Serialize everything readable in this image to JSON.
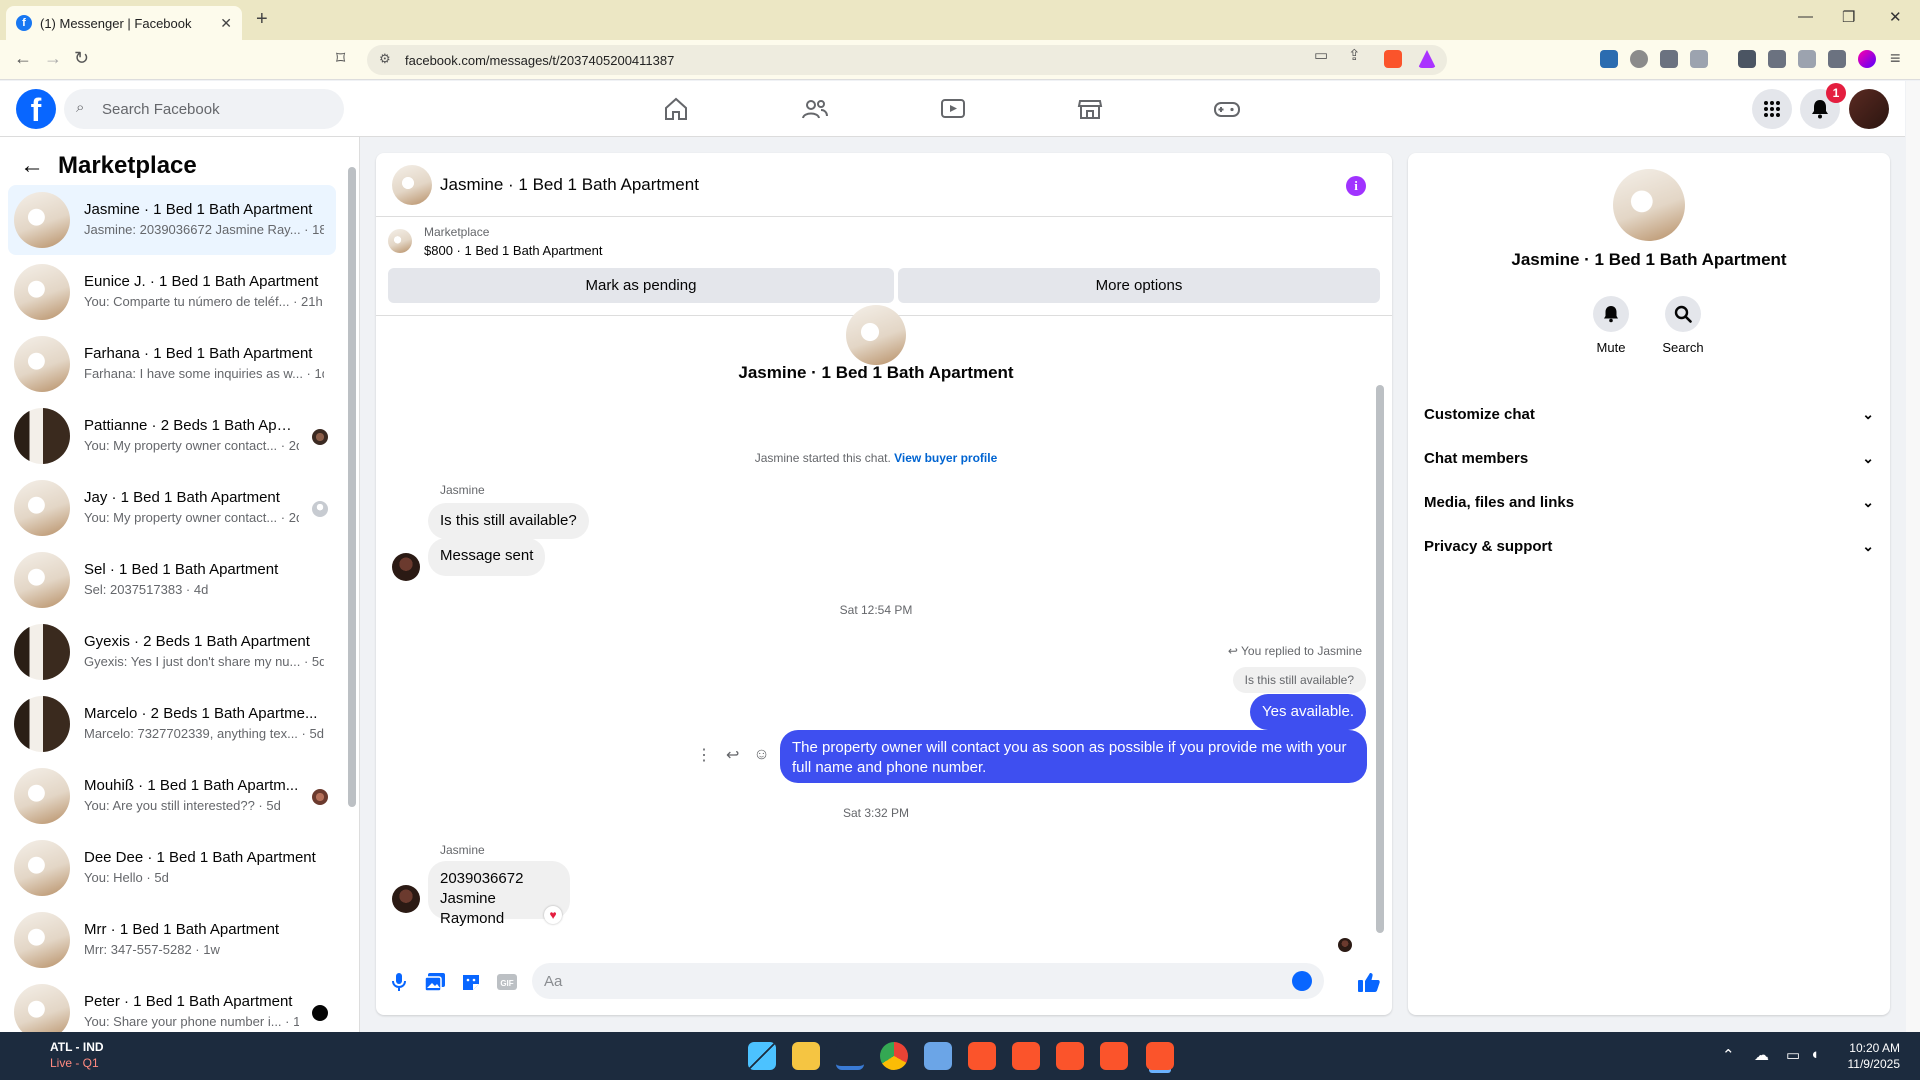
{
  "browser": {
    "tab_title": "(1) Messenger | Facebook",
    "url": "facebook.com/messages/t/2037405200411387"
  },
  "topbar": {
    "search_placeholder": "Search Facebook",
    "notification_count": "1"
  },
  "sidebar": {
    "title": "Marketplace",
    "conversations": [
      {
        "name": "Jasmine · 1 Bed 1 Bath Apartment",
        "preview": "Jasmine: 2039036672 Jasmine Ray... · 18h",
        "thumb": "light",
        "active": true
      },
      {
        "name": "Eunice J. · 1 Bed 1 Bath Apartment",
        "preview": "You: Comparte tu número de teléf... · 21h",
        "thumb": "light",
        "active": false
      },
      {
        "name": "Farhana · 1 Bed 1 Bath Apartment",
        "preview": "Farhana: I have some inquiries as w... · 1d",
        "thumb": "light",
        "active": false
      },
      {
        "name": "Pattianne · 2 Beds 1 Bath Apar...",
        "preview": "You: My property owner contact... · 2d",
        "thumb": "dark",
        "active": false
      },
      {
        "name": "Jay · 1 Bed 1 Bath Apartment",
        "preview": "You: My property owner contact... · 2d",
        "thumb": "light",
        "active": false
      },
      {
        "name": "Sel · 1 Bed 1 Bath Apartment",
        "preview": "Sel: 2037517383 · 4d",
        "thumb": "light",
        "active": false
      },
      {
        "name": "Gyexis · 2 Beds 1 Bath Apartment",
        "preview": "Gyexis: Yes I just don't share my nu... · 5d",
        "thumb": "dark",
        "active": false
      },
      {
        "name": "Marcelo · 2 Beds 1 Bath Apartme...",
        "preview": "Marcelo: 7327702339, anything tex... · 5d",
        "thumb": "dark",
        "active": false
      },
      {
        "name": "Mouhiß · 1 Bed 1 Bath Apartm...",
        "preview": "You: Are you still interested?? · 5d",
        "thumb": "light",
        "active": false
      },
      {
        "name": "Dee Dee · 1 Bed 1 Bath Apartment",
        "preview": "You: Hello · 5d",
        "thumb": "light",
        "active": false
      },
      {
        "name": "Mrr · 1 Bed 1 Bath Apartment",
        "preview": "Mrr: 347-557-5282 · 1w",
        "thumb": "light",
        "active": false
      },
      {
        "name": "Peter · 1 Bed 1 Bath Apartment",
        "preview": "You: Share your phone number i... · 1w",
        "thumb": "light",
        "active": false
      }
    ]
  },
  "chat": {
    "title": "Jasmine · 1 Bed 1 Bath Apartment",
    "listing_source": "Marketplace",
    "listing_title": "$800 · 1 Bed 1 Bath Apartment",
    "mark_pending": "Mark as pending",
    "more_options": "More options",
    "intro_title": "Jasmine · 1 Bed 1 Bath Apartment",
    "started_text": "Jasmine started this chat.",
    "view_profile": "View buyer profile",
    "sender": "Jasmine",
    "msg1": "Is this still available?",
    "msg2": "Message sent",
    "time1": "Sat 12:54 PM",
    "replied_to": "You replied to Jasmine",
    "quoted": "Is this still available?",
    "reply1": "Yes available.",
    "reply2": "The property owner will contact you as soon as possible if you provide me with your full name and phone number.",
    "time2": "Sat 3:32 PM",
    "msg3_line1": "2039036672",
    "msg3_line2": "Jasmine Raymond",
    "composer_placeholder": "Aa"
  },
  "details": {
    "name": "Jasmine · 1 Bed 1 Bath Apartment",
    "mute": "Mute",
    "search": "Search",
    "sections": [
      "Customize chat",
      "Chat members",
      "Media, files and links",
      "Privacy & support"
    ]
  },
  "taskbar": {
    "weather_line1": "ATL - IND",
    "weather_line2": "Live - Q1",
    "time": "10:20 AM",
    "date": "11/9/2025"
  },
  "colors": {
    "facebook_blue": "#0866ff",
    "outgoing_bubble": "#3e4ff0",
    "badge_red": "#e41e3f"
  }
}
